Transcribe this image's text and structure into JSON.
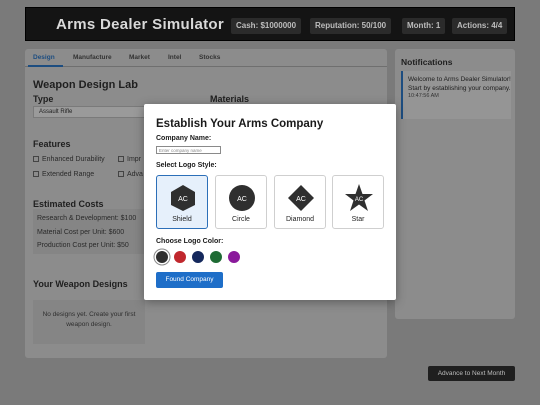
{
  "header": {
    "title": "Arms Dealer Simulator",
    "cash": "Cash: $1000000",
    "reputation": "Reputation: 50/100",
    "month": "Month: 1",
    "actions": "Actions: 4/4"
  },
  "tabs": [
    {
      "label": "Design"
    },
    {
      "label": "Manufacture"
    },
    {
      "label": "Market"
    },
    {
      "label": "Intel"
    },
    {
      "label": "Stocks"
    }
  ],
  "design": {
    "title": "Weapon Design Lab",
    "type_label": "Type",
    "type_value": "Assault Rifle",
    "materials_label": "Materials",
    "features_label": "Features",
    "features": [
      "Enhanced Durability",
      "Impr",
      "Extended Range",
      "Adva"
    ],
    "costs_label": "Estimated Costs",
    "costs": [
      "Research & Development: $100",
      "Material Cost per Unit: $600",
      "Production Cost per Unit: $50"
    ],
    "designs_label": "Your Weapon Designs",
    "designs_empty": "No designs yet. Create your first weapon design."
  },
  "notifications": {
    "title": "Notifications",
    "items": [
      {
        "text": "Welcome to Arms Dealer Simulator! Start by establishing your company.",
        "time": "10:47:56 AM"
      }
    ]
  },
  "advance_label": "Advance to Next Month",
  "modal": {
    "title": "Establish Your Arms Company",
    "name_label": "Company Name:",
    "name_placeholder": "Enter company name",
    "logo_style_label": "Select Logo Style:",
    "logo_initials": "AC",
    "logo_styles": [
      {
        "label": "Shield",
        "icon": "hexagon-icon",
        "selected": true
      },
      {
        "label": "Circle",
        "icon": "circle-icon",
        "selected": false
      },
      {
        "label": "Diamond",
        "icon": "diamond-icon",
        "selected": false
      },
      {
        "label": "Star",
        "icon": "star-icon",
        "selected": false
      }
    ],
    "logo_color_label": "Choose Logo Color:",
    "colors": [
      "#2f2f2f",
      "#c0272d",
      "#14285c",
      "#1e6b34",
      "#8a1a9b"
    ],
    "selected_color": "#2f2f2f",
    "submit_label": "Found Company"
  }
}
